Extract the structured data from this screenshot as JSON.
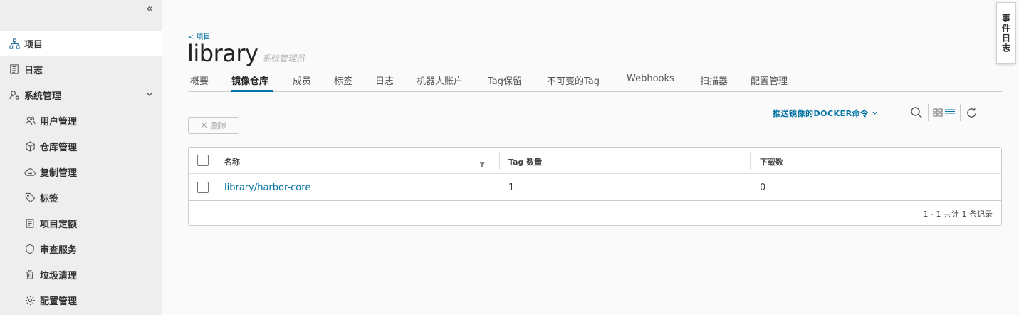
{
  "sidebar": {
    "collapse_icon": "«",
    "items": [
      {
        "label": "项目",
        "icon": "projects-icon"
      },
      {
        "label": "日志",
        "icon": "logs-icon"
      },
      {
        "label": "系统管理",
        "icon": "admin-icon"
      },
      {
        "label": "用户管理",
        "icon": "users-icon"
      },
      {
        "label": "仓库管理",
        "icon": "registry-icon"
      },
      {
        "label": "复制管理",
        "icon": "replication-icon"
      },
      {
        "label": "标签",
        "icon": "tag-icon"
      },
      {
        "label": "项目定额",
        "icon": "quota-icon"
      },
      {
        "label": "审查服务",
        "icon": "shield-icon"
      },
      {
        "label": "垃圾清理",
        "icon": "trash-icon"
      },
      {
        "label": "配置管理",
        "icon": "gear-icon"
      }
    ]
  },
  "header": {
    "back_link": "< 项目",
    "title": "library",
    "role": "系统管理员"
  },
  "tabs": [
    {
      "label": "概要"
    },
    {
      "label": "镜像仓库"
    },
    {
      "label": "成员"
    },
    {
      "label": "标签"
    },
    {
      "label": "日志"
    },
    {
      "label": "机器人账户"
    },
    {
      "label": "Tag保留"
    },
    {
      "label": "不可变的Tag"
    },
    {
      "label": "Webhooks"
    },
    {
      "label": "扫描器"
    },
    {
      "label": "配置管理"
    }
  ],
  "toolbar": {
    "push_command": "推送镜像的DOCKER命令",
    "delete_label": "删除"
  },
  "table": {
    "columns": [
      "名称",
      "Tag 数量",
      "下载数"
    ],
    "rows": [
      {
        "name": "library/harbor-core",
        "tag_count": "1",
        "downloads": "0"
      }
    ],
    "footer": "1 - 1 共计 1 条记录"
  },
  "event_log_tab": "事件日志",
  "colors": {
    "accent": "#0072a3",
    "sidebar_bg": "#eeeeee",
    "page_bg": "#fafafa"
  }
}
